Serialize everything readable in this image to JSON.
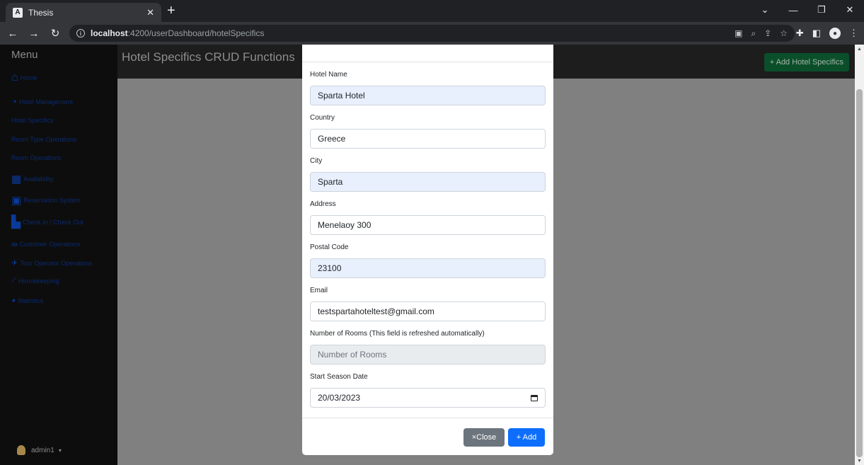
{
  "browser": {
    "tab_title": "Thesis",
    "tab_favicon": "A",
    "url_host": "localhost",
    "url_path": ":4200/userDashboard/hotelSpecifics"
  },
  "sidebar": {
    "title": "Menu",
    "items": [
      {
        "label": "Home",
        "icon": "home-icon"
      },
      {
        "label": "Hotel Management",
        "icon": "dashboard-gauge-icon"
      },
      {
        "label": "Hotel Specifics",
        "icon": ""
      },
      {
        "label": "Room Type Operations",
        "icon": ""
      },
      {
        "label": "Room Operations",
        "icon": ""
      },
      {
        "label": "Availability",
        "icon": "table-grid-icon"
      },
      {
        "label": "Reservation System",
        "icon": "calendar-icon"
      },
      {
        "label": "Check In / Check Out",
        "icon": "hotel-building-icon"
      },
      {
        "label": "Customer Operations",
        "icon": "people-icon"
      },
      {
        "label": "Tour Operator Operations",
        "icon": "plane-icon"
      },
      {
        "label": "Housekeeping",
        "icon": "broom-icon"
      },
      {
        "label": "Statistics",
        "icon": "pie-chart-icon"
      }
    ],
    "user": "admin1"
  },
  "header": {
    "title": "Hotel Specifics CRUD Functions",
    "add_button": "+ Add Hotel Specifics"
  },
  "modal": {
    "fields": [
      {
        "label": "Hotel Name",
        "value": "Sparta Hotel"
      },
      {
        "label": "Country",
        "value": "Greece"
      },
      {
        "label": "City",
        "value": "Sparta"
      },
      {
        "label": "Address",
        "value": "Menelaoy 300"
      },
      {
        "label": "Postal Code",
        "value": "23100"
      },
      {
        "label": "Email",
        "value": "testspartahoteltest@gmail.com"
      },
      {
        "label": "Number of Rooms (This field is refreshed automatically)",
        "placeholder": "Number of Rooms"
      },
      {
        "label": "Start Season Date",
        "value": "20/03/2023"
      }
    ],
    "close_label": "×Close",
    "add_label": "+ Add"
  },
  "colors": {
    "primary": "#0d6efd",
    "secondary": "#6c757d",
    "autofill": "#e8f0fe",
    "success_dim": "#0b4f2a"
  }
}
